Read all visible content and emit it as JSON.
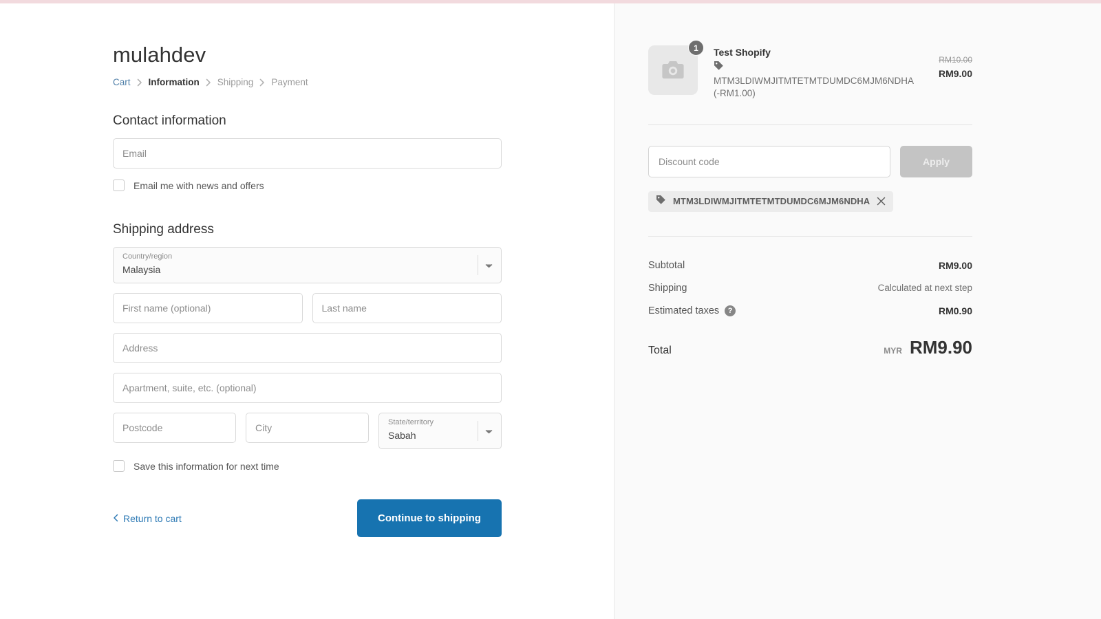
{
  "theme": {
    "top_border_color": "#f2dade",
    "accent_blue": "#1773b0",
    "link_blue": "#2e7ab5",
    "panel_bg": "#fafafa"
  },
  "header": {
    "shop_name": "mulahdev",
    "breadcrumb": {
      "cart": "Cart",
      "information": "Information",
      "shipping": "Shipping",
      "payment": "Payment",
      "separator": "chevron-right-icon"
    }
  },
  "contact": {
    "title": "Contact information",
    "email_placeholder": "Email",
    "email_value": "",
    "newsletter_label": "Email me with news and offers",
    "newsletter_checked": false
  },
  "shipping": {
    "title": "Shipping address",
    "country": {
      "label": "Country/region",
      "value": "Malaysia"
    },
    "first_name_placeholder": "First name (optional)",
    "first_name_value": "",
    "last_name_placeholder": "Last name",
    "last_name_value": "",
    "address_placeholder": "Address",
    "address_value": "",
    "apartment_placeholder": "Apartment, suite, etc. (optional)",
    "apartment_value": "",
    "postcode_placeholder": "Postcode",
    "postcode_value": "",
    "city_placeholder": "City",
    "city_value": "",
    "state": {
      "label": "State/territory",
      "value": "Sabah"
    },
    "save_info_label": "Save this information for next time",
    "save_info_checked": false
  },
  "actions": {
    "return_to_cart": "Return to cart",
    "return_icon": "chevron-left-icon",
    "continue_button": "Continue to shipping"
  },
  "summary": {
    "item": {
      "title": "Test Shopify",
      "quantity": "1",
      "image_icon": "camera-placeholder-icon",
      "discount_icon": "tag-icon",
      "discount_text": "MTM3LDIWMJITMTETMTDUMDC6MJM6NDHA (-RM1.00)",
      "original_price": "RM10.00",
      "price": "RM9.00"
    },
    "discount": {
      "placeholder": "Discount code",
      "value": "",
      "apply_label": "Apply",
      "applied_code": "MTM3LDIWMJITMTETMTDUMDC6MJM6NDHA",
      "remove_icon": "close-icon",
      "tag_icon": "tag-icon"
    },
    "totals": [
      {
        "label": "Subtotal",
        "value": "RM9.00",
        "muted": false,
        "help": false
      },
      {
        "label": "Shipping",
        "value": "Calculated at next step",
        "muted": true,
        "help": false
      },
      {
        "label": "Estimated taxes",
        "value": "RM0.90",
        "muted": false,
        "help": true
      }
    ],
    "total": {
      "label": "Total",
      "currency": "MYR",
      "value": "RM9.90"
    }
  }
}
